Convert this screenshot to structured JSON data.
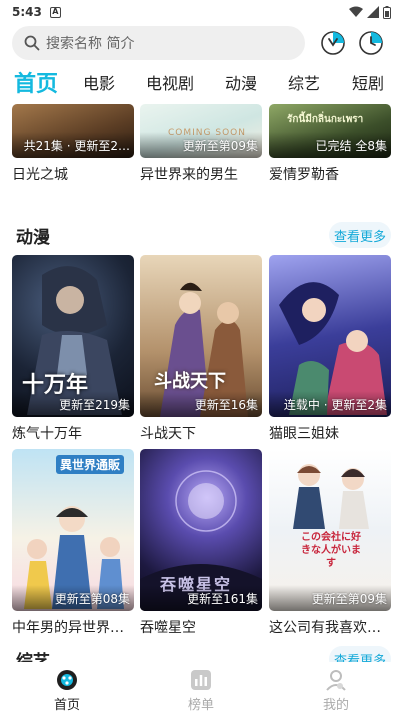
{
  "status_bar": {
    "time": "5:43",
    "notif": "A"
  },
  "search": {
    "placeholder": "搜索名称 简介"
  },
  "tabs": [
    "首页",
    "电影",
    "电视剧",
    "动漫",
    "综艺",
    "短剧"
  ],
  "top_row": [
    {
      "title": "日光之城",
      "badge": "共21集 · 更新至2…",
      "colors": [
        "#7a5a3a",
        "#c79a62",
        "#3b2a1e"
      ]
    },
    {
      "title": "异世界来的男生",
      "badge": "更新至第09集",
      "poster_text": "COMING SOON",
      "colors": [
        "#d8ecea",
        "#f3e9d6",
        "#b9d7d4"
      ]
    },
    {
      "title": "爱情罗勒香",
      "badge": "已完结 全8集",
      "poster_text": "รักนี้มีกลิ่นกะเพรา",
      "colors": [
        "#6f8b52",
        "#2d3c22",
        "#9fb56c"
      ]
    }
  ],
  "sections": [
    {
      "title": "动漫",
      "more": "查看更多"
    },
    {
      "title": "综艺",
      "more": "查看更多"
    }
  ],
  "anime_row1": [
    {
      "title": "炼气十万年",
      "badge": "更新至219集",
      "poster_text": "十万年",
      "colors": [
        "#1c2637",
        "#3a4b66",
        "#0c1220"
      ]
    },
    {
      "title": "斗战天下",
      "badge": "更新至16集",
      "poster_text": "斗战天下",
      "colors": [
        "#d9c3a2",
        "#8a6a4a",
        "#f2e4cc"
      ]
    },
    {
      "title": "猫眼三姐妹",
      "badge": "连载中 · 更新至2集",
      "colors": [
        "#2b2c7c",
        "#8c8fe0",
        "#c95078"
      ]
    }
  ],
  "anime_row2": [
    {
      "title": "中年男的异世界…",
      "badge": "更新至第08集",
      "poster_text": "異世界通販",
      "colors": [
        "#3aa6d8",
        "#f2c74a",
        "#6fc2e6"
      ]
    },
    {
      "title": "吞噬星空",
      "badge": "更新至161集",
      "poster_text": "吞噬星空",
      "colors": [
        "#2a2550",
        "#8a7ad8",
        "#11102a"
      ]
    },
    {
      "title": "这公司有我喜欢…",
      "badge": "更新至第09集",
      "poster_text": "この会社に好きな人がいます",
      "colors": [
        "#f4f1ec",
        "#b9d3e8",
        "#e9a1a8"
      ]
    }
  ],
  "nav": [
    {
      "label": "首页",
      "icon": "home-icon",
      "active": true
    },
    {
      "label": "榜单",
      "icon": "chart-icon",
      "active": false
    },
    {
      "label": "我的",
      "icon": "profile-icon",
      "active": false
    }
  ],
  "colors": {
    "accent": "#14b9df",
    "more_text": "#14a9d8"
  }
}
